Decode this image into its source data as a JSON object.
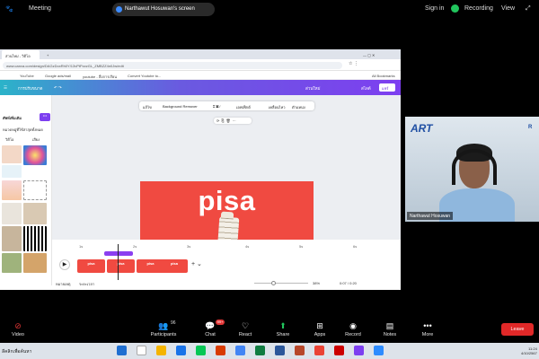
{
  "topbar": {
    "meeting_label": "Meeting",
    "share_label": "Narthawut Hosuwan's screen",
    "sign_in": "Sign in",
    "recording": "Recording",
    "view": "View"
  },
  "browser": {
    "tab_title": "ส่วนใหม่ - วิดีโอ",
    "url": "www.canva.com/design/DAGzDoxRh0Y/13vPtPzzzGL_ZMBZZ4n0Jw/edit",
    "bookmarks": [
      "YouTube",
      "Google ads/mail",
      "youtube - สื่อการเรียน",
      "Convert Youtube to..."
    ],
    "all_bookmarks": "All Bookmarks"
  },
  "canva": {
    "header_item": "การปรับขนาด",
    "header_right": "ส่วนใหม่",
    "present": "สไลด์",
    "share": "แชร์",
    "left_title": "ศัพท์เพิ่มเติม",
    "left_sub": "หมวดหมู่ที่ใช้ล่าสุดทั้งหมด",
    "left_tab1": "วิดีโอ",
    "left_tab2": "เสียง",
    "toolbar": {
      "edit": "แก้ไข",
      "bg_remover": "Background Remover",
      "effects": "เอฟเฟ็กต์",
      "animate": "เคลื่อนไหว",
      "position": "ตำแหน่ง"
    },
    "slide_title": "pisa",
    "clip_label": "pisa",
    "ruler": [
      "1s",
      "2s",
      "3s",
      "4s",
      "5s",
      "6s"
    ],
    "notes": "หมายเหตุ",
    "duration": "ระยะเวลา",
    "zoom": "38%",
    "time": "0:07 / 0:20"
  },
  "participant": {
    "name": "Narthawut Hosuwan",
    "logo": "ART",
    "logo_right": "R"
  },
  "zoombar": {
    "items": [
      "Video",
      "Participants",
      "Chat",
      "React",
      "Share",
      "Apps",
      "Record",
      "Notes",
      "More"
    ],
    "participants_count": "96",
    "chat_badge": "99+",
    "leave": "Leave"
  },
  "taskbar": {
    "left_text": "ลีคลิกเพื่อค้นหา",
    "time": "11:24",
    "date": "4/10/2567"
  },
  "colors": {
    "slide_bg": "#f04a41",
    "canva_purple": "#7d3ff0",
    "leave_red": "#e02828",
    "recording_green": "#21c55d"
  }
}
